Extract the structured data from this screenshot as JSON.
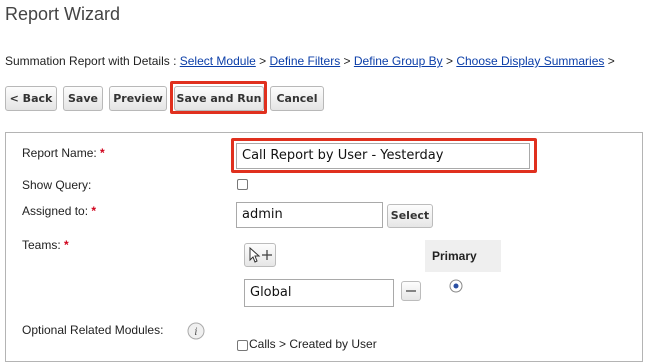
{
  "page": {
    "title": "Report Wizard"
  },
  "breadcrumb": {
    "prefix": "Summation Report with Details :",
    "sep": ">",
    "steps": [
      "Select Module",
      "Define Filters",
      "Define Group By",
      "Choose Display Summaries"
    ]
  },
  "toolbar": {
    "back_label": "< Back",
    "save_label": "Save",
    "preview_label": "Preview",
    "save_run_label": "Save and Run",
    "cancel_label": "Cancel"
  },
  "form": {
    "report_name_label": "Report Name:",
    "report_name_value": "Call Report by User - Yesterday",
    "show_query_label": "Show Query:",
    "assigned_to_label": "Assigned to:",
    "assigned_to_value": "admin",
    "select_label": "Select",
    "teams_label": "Teams:",
    "primary_header": "Primary",
    "team_value": "Global",
    "optional_related_label": "Optional Related Modules:",
    "related_option_label": "Calls > Created by User",
    "required_marker": "*"
  },
  "colors": {
    "link": "#0b3ea8",
    "highlight": "#e0301e",
    "required": "#d0021b"
  }
}
